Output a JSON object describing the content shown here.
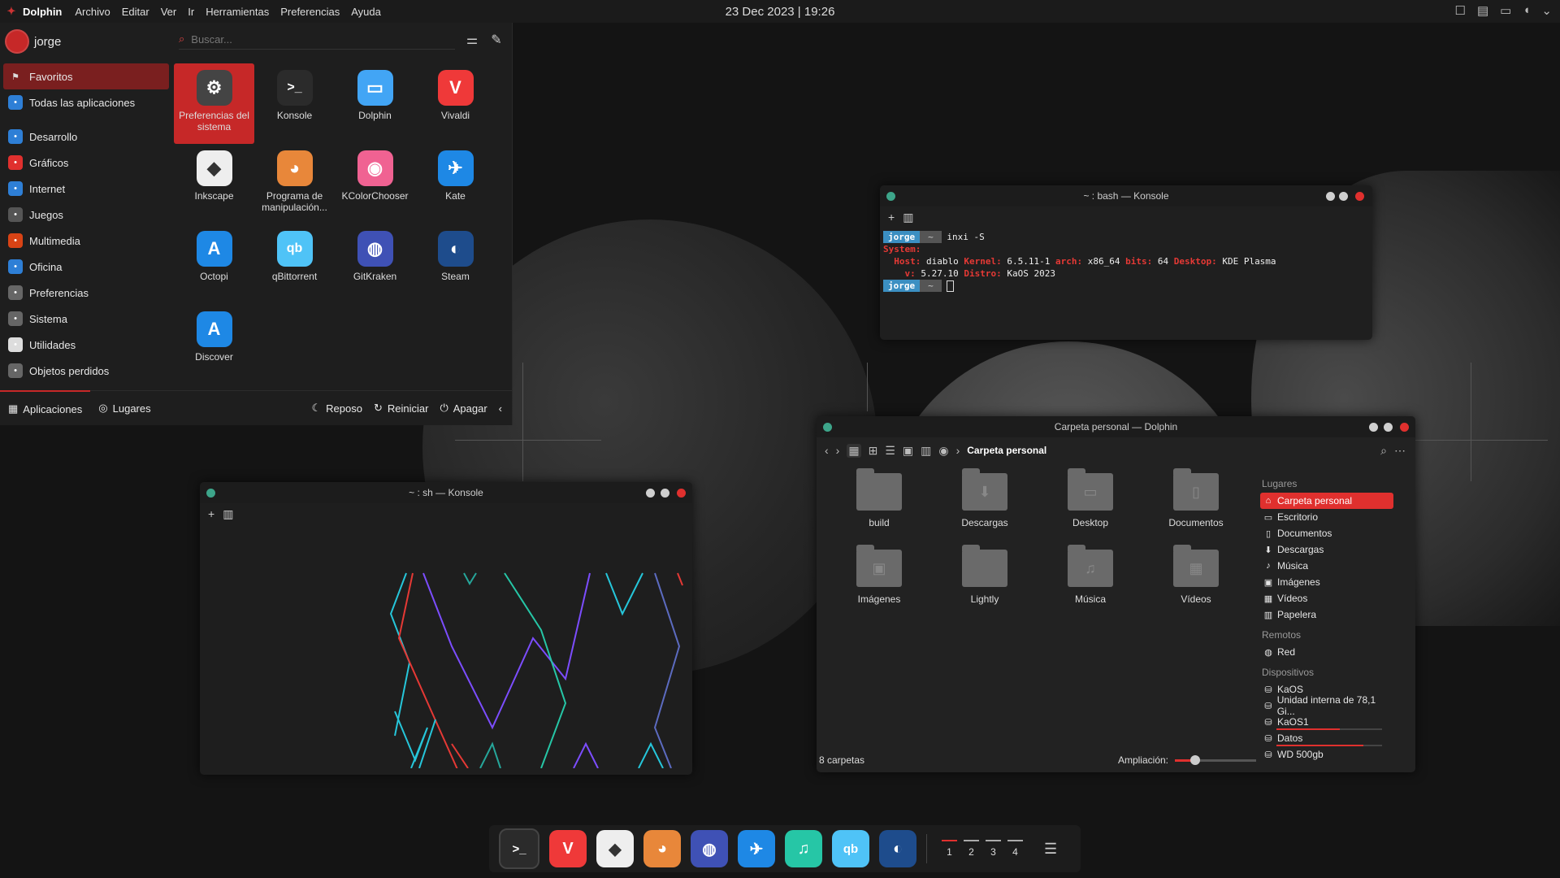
{
  "topbar": {
    "app_name": "Dolphin",
    "menus": [
      "Archivo",
      "Editar",
      "Ver",
      "Ir",
      "Herramientas",
      "Preferencias",
      "Ayuda"
    ],
    "clock": "23 Dec 2023 | 19:26"
  },
  "launcher": {
    "user": "jorge",
    "search_placeholder": "Buscar...",
    "categories": [
      {
        "label": "Favoritos",
        "icon": "bookmark-icon",
        "color": "#7a1f1f"
      },
      {
        "label": "Todas las aplicaciones",
        "icon": "grid-icon",
        "color": "#2e7fd6"
      },
      {
        "label": "Desarrollo",
        "icon": "dev-icon",
        "color": "#2e7fd6"
      },
      {
        "label": "Gráficos",
        "icon": "graphics-icon",
        "color": "#e0302e"
      },
      {
        "label": "Internet",
        "icon": "internet-icon",
        "color": "#2e7fd6"
      },
      {
        "label": "Juegos",
        "icon": "gamepad-icon",
        "color": "#555555"
      },
      {
        "label": "Multimedia",
        "icon": "multimedia-icon",
        "color": "#d84315"
      },
      {
        "label": "Oficina",
        "icon": "office-icon",
        "color": "#2e7fd6"
      },
      {
        "label": "Preferencias",
        "icon": "settings-icon",
        "color": "#666666"
      },
      {
        "label": "Sistema",
        "icon": "system-icon",
        "color": "#666666"
      },
      {
        "label": "Utilidades",
        "icon": "utilities-icon",
        "color": "#dddddd"
      },
      {
        "label": "Objetos perdidos",
        "icon": "lost-icon",
        "color": "#666666"
      }
    ],
    "apps": [
      {
        "label": "Preferencias del sistema",
        "icon": "settings-icon",
        "glyph": "⚙",
        "color": "#444444"
      },
      {
        "label": "Konsole",
        "icon": "terminal-icon",
        "glyph": ">_",
        "color": "#2b2b2b"
      },
      {
        "label": "Dolphin",
        "icon": "folder-icon",
        "glyph": "▭",
        "color": "#42a5f5"
      },
      {
        "label": "Vivaldi",
        "icon": "vivaldi-icon",
        "glyph": "V",
        "color": "#ef3939"
      },
      {
        "label": "Inkscape",
        "icon": "inkscape-icon",
        "glyph": "◆",
        "color": "#eeeeee"
      },
      {
        "label": "Programa de manipulación...",
        "icon": "gimp-icon",
        "glyph": "◕",
        "color": "#e8873a"
      },
      {
        "label": "KColorChooser",
        "icon": "color-wheel-icon",
        "glyph": "◉",
        "color": "#f06292"
      },
      {
        "label": "Kate",
        "icon": "kate-icon",
        "glyph": "✈",
        "color": "#1e88e5"
      },
      {
        "label": "Octopi",
        "icon": "octopi-icon",
        "glyph": "A",
        "color": "#1e88e5"
      },
      {
        "label": "qBittorrent",
        "icon": "qbittorrent-icon",
        "glyph": "qb",
        "color": "#4fc3f7"
      },
      {
        "label": "GitKraken",
        "icon": "gitkraken-icon",
        "glyph": "◍",
        "color": "#3f51b5"
      },
      {
        "label": "Steam",
        "icon": "steam-icon",
        "glyph": "◐",
        "color": "#1e4c8c"
      },
      {
        "label": "Discover",
        "icon": "discover-icon",
        "glyph": "A",
        "color": "#1e88e5"
      }
    ],
    "footer": {
      "tab_apps": "Aplicaciones",
      "tab_places": "Lugares",
      "sleep": "Reposo",
      "restart": "Reiniciar",
      "shutdown": "Apagar"
    }
  },
  "konsole_top": {
    "title": "~ : bash — Konsole",
    "prompt_user": "jorge",
    "prompt_dir": "~",
    "command": "inxi -S",
    "system_label": "System:",
    "host_label": "Host:",
    "host": "diablo",
    "kernel_label": "Kernel:",
    "kernel": "6.5.11-1",
    "arch_label": "arch:",
    "arch": "x86_64",
    "bits_label": "bits:",
    "bits": "64",
    "desktop_label": "Desktop:",
    "desktop": "KDE Plasma",
    "v_label": "v:",
    "v": "5.27.10",
    "distro_label": "Distro:",
    "distro": "KaOS 2023"
  },
  "konsole_bottom": {
    "title": "~ : sh — Konsole"
  },
  "dolphin": {
    "title": "Carpeta personal — Dolphin",
    "breadcrumb": "Carpeta personal",
    "folders": [
      {
        "label": "build",
        "icon": "folder-icon",
        "glyph": ""
      },
      {
        "label": "Descargas",
        "icon": "download-folder-icon",
        "glyph": "⬇"
      },
      {
        "label": "Desktop",
        "icon": "desktop-folder-icon",
        "glyph": "▭"
      },
      {
        "label": "Documentos",
        "icon": "documents-folder-icon",
        "glyph": "▯"
      },
      {
        "label": "Imágenes",
        "icon": "pictures-folder-icon",
        "glyph": "▣"
      },
      {
        "label": "Lightly",
        "icon": "folder-icon",
        "glyph": ""
      },
      {
        "label": "Música",
        "icon": "music-folder-icon",
        "glyph": "♫"
      },
      {
        "label": "Vídeos",
        "icon": "videos-folder-icon",
        "glyph": "▦"
      }
    ],
    "places_header": "Lugares",
    "places": [
      {
        "label": "Carpeta personal",
        "icon": "home-icon",
        "glyph": "⌂"
      },
      {
        "label": "Escritorio",
        "icon": "desktop-icon",
        "glyph": "▭"
      },
      {
        "label": "Documentos",
        "icon": "document-icon",
        "glyph": "▯"
      },
      {
        "label": "Descargas",
        "icon": "download-icon",
        "glyph": "⬇"
      },
      {
        "label": "Música",
        "icon": "music-icon",
        "glyph": "♪"
      },
      {
        "label": "Imágenes",
        "icon": "image-icon",
        "glyph": "▣"
      },
      {
        "label": "Vídeos",
        "icon": "video-icon",
        "glyph": "▦"
      },
      {
        "label": "Papelera",
        "icon": "trash-icon",
        "glyph": "▥"
      }
    ],
    "remote_header": "Remotos",
    "remote": [
      {
        "label": "Red",
        "icon": "network-icon",
        "glyph": "◍"
      }
    ],
    "devices_header": "Dispositivos",
    "devices": [
      {
        "label": "KaOS",
        "icon": "drive-icon",
        "glyph": "⛁",
        "usage": null
      },
      {
        "label": "Unidad interna de 78,1 Gi...",
        "icon": "drive-icon",
        "glyph": "⛁",
        "usage": null
      },
      {
        "label": "KaOS1",
        "icon": "drive-icon",
        "glyph": "⛁",
        "usage": 0.6
      },
      {
        "label": "Datos",
        "icon": "drive-icon",
        "glyph": "⛁",
        "usage": 0.82
      },
      {
        "label": "WD 500gb",
        "icon": "drive-icon",
        "glyph": "⛁",
        "usage": null
      }
    ],
    "status": "8 carpetas",
    "zoom_label": "Ampliación:",
    "zoom_level": 0.25
  },
  "dock": {
    "apps": [
      {
        "name": "konsole",
        "glyph": ">_",
        "color": "#2b2b2b"
      },
      {
        "name": "vivaldi",
        "glyph": "V",
        "color": "#ef3939"
      },
      {
        "name": "inkscape",
        "glyph": "◆",
        "color": "#eeeeee"
      },
      {
        "name": "gimp",
        "glyph": "◕",
        "color": "#e8873a"
      },
      {
        "name": "gitkraken",
        "glyph": "◍",
        "color": "#3f51b5"
      },
      {
        "name": "kate",
        "glyph": "✈",
        "color": "#1e88e5"
      },
      {
        "name": "music",
        "glyph": "♫",
        "color": "#26c6a6"
      },
      {
        "name": "qbittorrent",
        "glyph": "qb",
        "color": "#4fc3f7"
      },
      {
        "name": "steam",
        "glyph": "◐",
        "color": "#1e4c8c"
      }
    ],
    "desktops": [
      "1",
      "2",
      "3",
      "4"
    ],
    "current_desktop": "1"
  }
}
